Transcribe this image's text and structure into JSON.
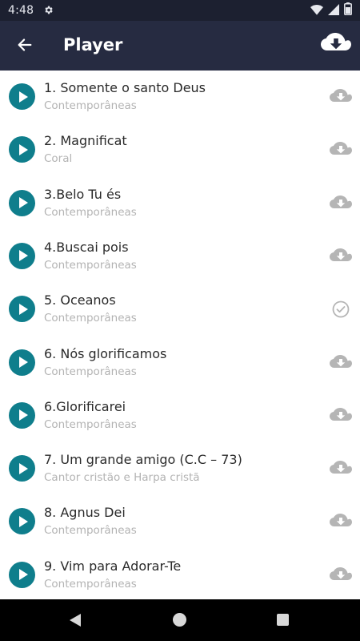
{
  "status_bar": {
    "time": "4:48",
    "icons": [
      "gear-icon",
      "wifi-icon",
      "signal-icon",
      "battery-icon"
    ]
  },
  "app_bar": {
    "title": "Player",
    "back_icon": "arrow-left-icon",
    "action_icon": "cloud-download-icon"
  },
  "colors": {
    "status_bar_bg": "#1c2030",
    "app_bar_bg": "#262b41",
    "play_button": "#0f7e8c",
    "title_text": "#2a2a2a",
    "subtitle_text": "#b3b3b3",
    "action_icon": "#b5b5b5"
  },
  "tracks": [
    {
      "title": "1. Somente o santo Deus",
      "category": "Contemporâneas",
      "status": "download"
    },
    {
      "title": "2. Magnificat",
      "category": "Coral",
      "status": "download"
    },
    {
      "title": "3.Belo Tu és",
      "category": "Contemporâneas",
      "status": "download"
    },
    {
      "title": "4.Buscai pois",
      "category": "Contemporâneas",
      "status": "download"
    },
    {
      "title": "5. Oceanos",
      "category": "Contemporâneas",
      "status": "downloaded"
    },
    {
      "title": "6. Nós glorificamos",
      "category": "Contemporâneas",
      "status": "download"
    },
    {
      "title": "6.Glorificarei",
      "category": "Contemporâneas",
      "status": "download"
    },
    {
      "title": "7. Um grande amigo (C.C – 73)",
      "category": "Cantor cristão e Harpa cristã",
      "status": "download"
    },
    {
      "title": "8. Agnus Dei",
      "category": "Contemporâneas",
      "status": "download"
    },
    {
      "title": "9. Vim para Adorar-Te",
      "category": "Contemporâneas",
      "status": "download"
    }
  ],
  "nav_bar": {
    "icons": [
      "nav-back-icon",
      "nav-home-icon",
      "nav-recents-icon"
    ]
  }
}
